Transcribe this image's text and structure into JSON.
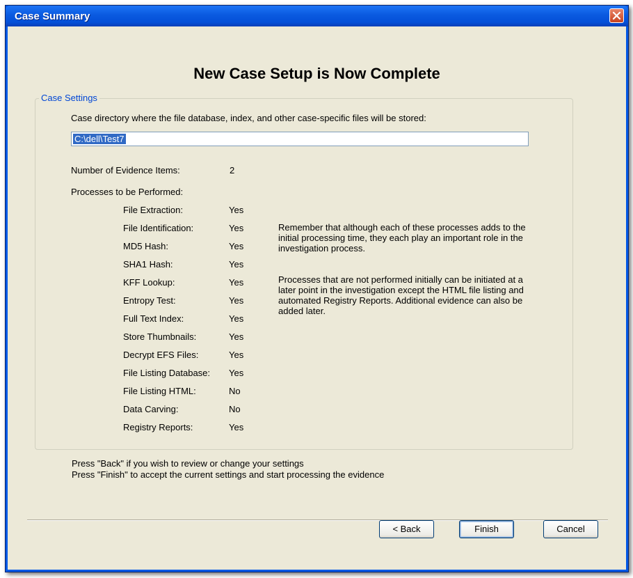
{
  "window": {
    "title": "Case Summary",
    "heading": "New Case Setup is Now Complete"
  },
  "case_settings": {
    "group_label": "Case Settings",
    "directory_prompt": "Case directory where the file database, index, and other case-specific files will be stored:",
    "directory_value": "C:\\dell\\Test7",
    "evidence_label": "Number of Evidence Items:",
    "evidence_value": "2",
    "processes_label": "Processes to be Performed:",
    "processes": [
      {
        "name": "File Extraction:",
        "value": "Yes"
      },
      {
        "name": "File Identification:",
        "value": "Yes"
      },
      {
        "name": "MD5 Hash:",
        "value": "Yes"
      },
      {
        "name": "SHA1 Hash:",
        "value": "Yes"
      },
      {
        "name": "KFF Lookup:",
        "value": "Yes"
      },
      {
        "name": "Entropy Test:",
        "value": "Yes"
      },
      {
        "name": "Full Text Index:",
        "value": "Yes"
      },
      {
        "name": "Store Thumbnails:",
        "value": "Yes"
      },
      {
        "name": "Decrypt EFS Files:",
        "value": "Yes"
      },
      {
        "name": "File Listing Database:",
        "value": "Yes"
      },
      {
        "name": "File Listing HTML:",
        "value": "No"
      },
      {
        "name": "Data Carving:",
        "value": "No"
      },
      {
        "name": "Registry Reports:",
        "value": "Yes"
      }
    ],
    "note_1": "Remember that although each of these processes adds to the initial processing time, they each play an important role in the investigation process.",
    "note_2": "Processes that are not performed initially can be initiated at a later point in the investigation except the HTML file listing and automated Registry Reports. Additional evidence can also be added later."
  },
  "instructions": {
    "back_hint": "Press \"Back\" if you wish to review or change your settings",
    "finish_hint": "Press \"Finish\" to accept the current settings and start processing the evidence"
  },
  "buttons": {
    "back": "< Back",
    "finish": "Finish",
    "cancel": "Cancel"
  },
  "icons": {
    "close": "close-icon"
  },
  "colors": {
    "titlebar": "#0a5ae0",
    "dialog_bg": "#ece9d8",
    "group_label": "#0046d5",
    "selection": "#316ac5",
    "close_button": "#c8421f"
  }
}
